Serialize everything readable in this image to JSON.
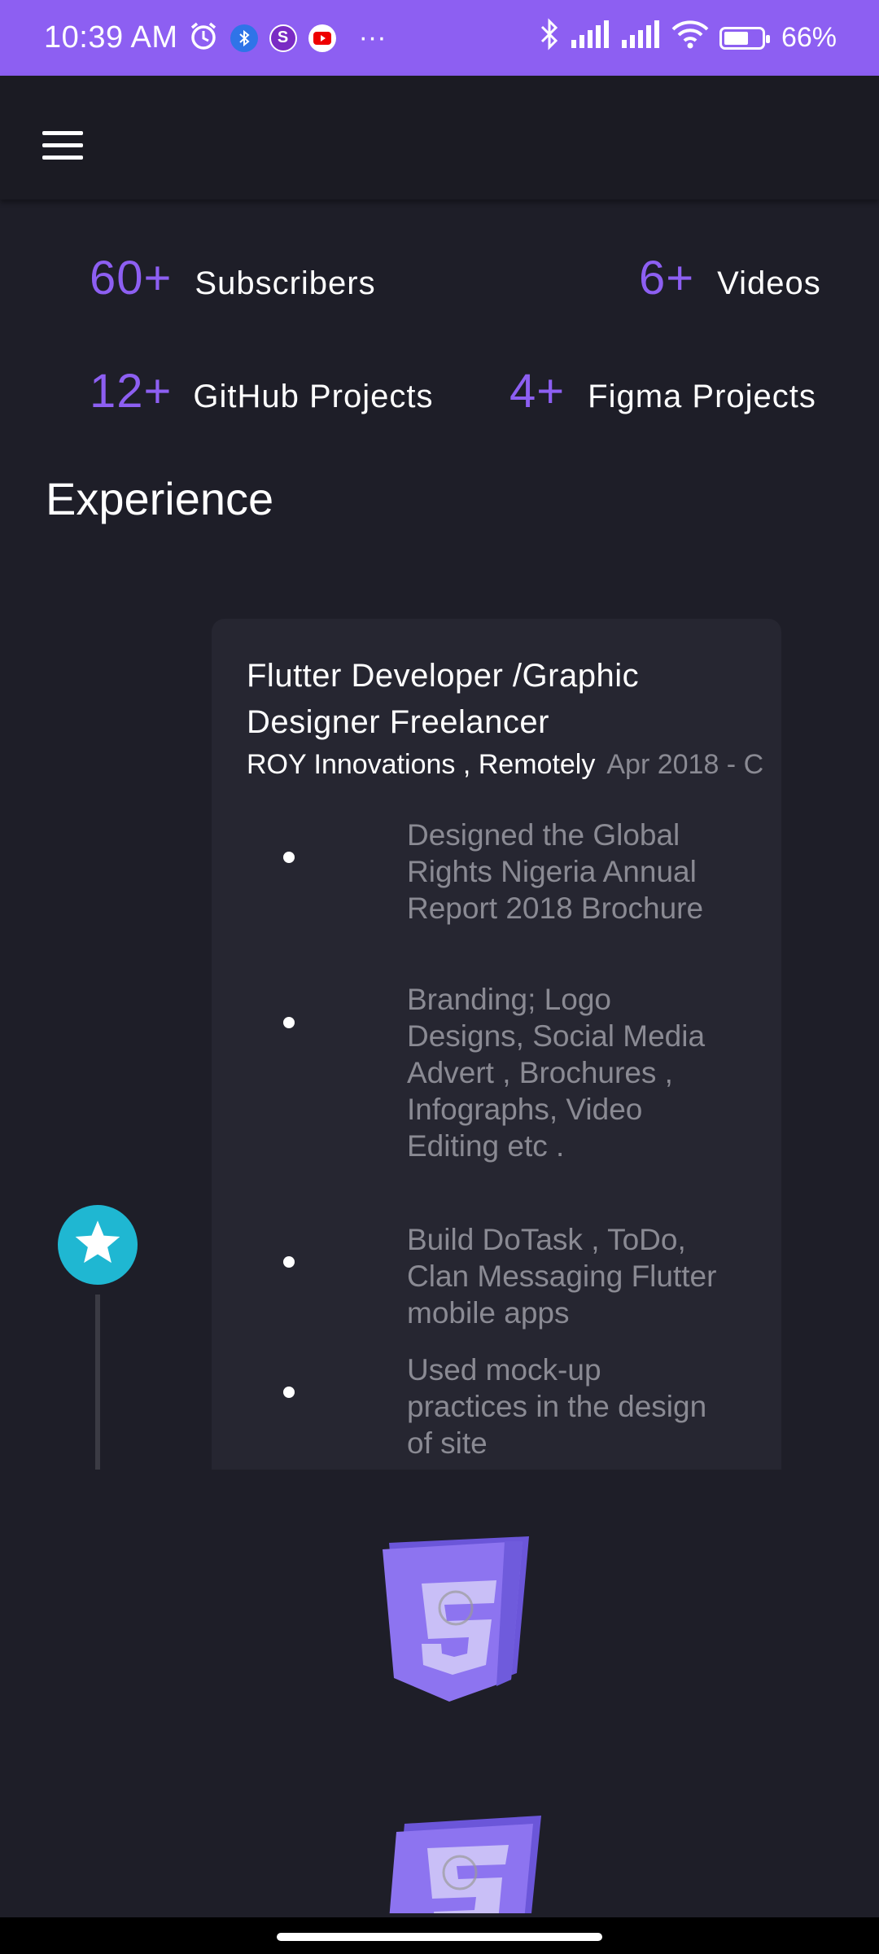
{
  "status_bar": {
    "time": "10:39 AM",
    "battery_text": "66%",
    "battery_level": 0.66,
    "more": "···"
  },
  "stats": [
    {
      "value": "60+",
      "label": "Subscribers"
    },
    {
      "value": "6+",
      "label": "Videos"
    },
    {
      "value": "12+",
      "label": "GitHub  Projects"
    },
    {
      "value": "4+",
      "label": "Figma Projects"
    }
  ],
  "section_title": "Experience",
  "experience": {
    "title": "Flutter  Developer /Graphic Designer  Freelancer",
    "company": "ROY Innovations , Remotely",
    "date": "Apr 2018 - C",
    "bullets": [
      "Designed the Global Rights Nigeria Annual Report 2018 Brochure",
      "Branding; Logo Designs, Social Media Advert , Brochures , Infographs, Video Editing etc .",
      "Build DoTask , ToDo, Clan Messaging Flutter mobile apps",
      "Used mock-up practices in the design of site"
    ]
  },
  "colors": {
    "accent": "#8d5ff2",
    "background": "#1e1e28",
    "card": "#262631",
    "timeline_node": "#1fb7d2"
  },
  "icons": [
    "alarm-icon",
    "bluetooth-icon",
    "skype-icon",
    "youtube-icon",
    "signal-icon",
    "wifi-icon",
    "battery-icon",
    "menu-icon",
    "star-icon",
    "html5-icon",
    "css3-icon"
  ]
}
